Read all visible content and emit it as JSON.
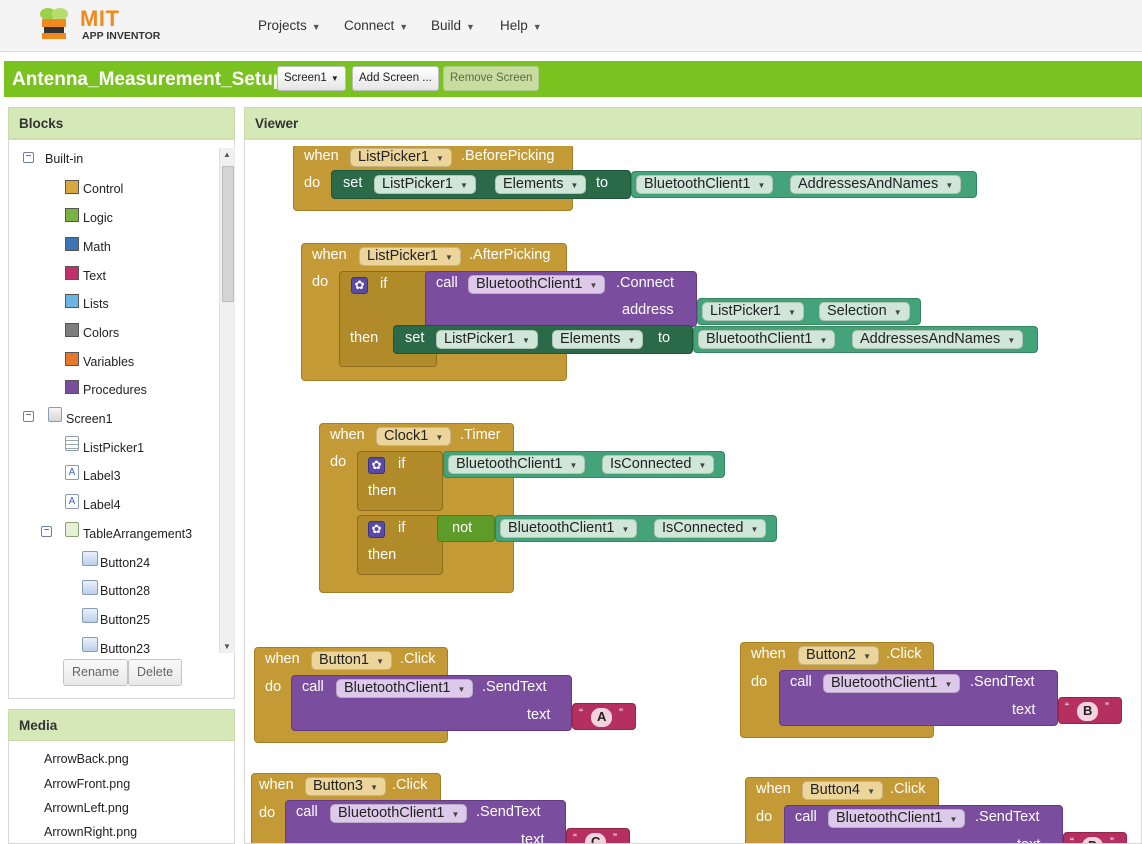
{
  "header": {
    "logo_title": "MIT",
    "logo_subtitle": "APP INVENTOR",
    "nav": [
      {
        "label": "Projects"
      },
      {
        "label": "Connect"
      },
      {
        "label": "Build"
      },
      {
        "label": "Help"
      }
    ]
  },
  "project": {
    "name": "Antenna_Measurement_Setup",
    "screen_select": "Screen1",
    "add_screen": "Add Screen ...",
    "remove_screen": "Remove Screen"
  },
  "blocks_panel": {
    "title": "Blocks",
    "builtin": {
      "label": "Built-in",
      "items": [
        {
          "label": "Control",
          "color": "#d9a93f"
        },
        {
          "label": "Logic",
          "color": "#7bb342"
        },
        {
          "label": "Math",
          "color": "#3d74b5"
        },
        {
          "label": "Text",
          "color": "#c2306c"
        },
        {
          "label": "Lists",
          "color": "#6bb3e0"
        },
        {
          "label": "Colors",
          "color": "#7d7d7d"
        },
        {
          "label": "Variables",
          "color": "#e6782d"
        },
        {
          "label": "Procedures",
          "color": "#7b4d9e"
        }
      ]
    },
    "screen": {
      "label": "Screen1",
      "components": [
        {
          "label": "ListPicker1",
          "icon": "listpicker-icon"
        },
        {
          "label": "Label3",
          "icon": "label-icon"
        },
        {
          "label": "Label4",
          "icon": "label-icon"
        }
      ],
      "arrangement": {
        "label": "TableArrangement3",
        "children": [
          {
            "label": "Button24"
          },
          {
            "label": "Button28"
          },
          {
            "label": "Button25"
          },
          {
            "label": "Button23"
          }
        ]
      }
    },
    "rename": "Rename",
    "delete": "Delete"
  },
  "media_panel": {
    "title": "Media",
    "files": [
      "ArrowBack.png",
      "ArrowFront.png",
      "ArrownLeft.png",
      "ArrownRight.png"
    ]
  },
  "viewer": {
    "title": "Viewer",
    "kw": {
      "when": "when",
      "do": "do",
      "set": "set",
      "to": "to",
      "call": "call",
      "if": "if",
      "then": "then",
      "not": "not",
      "address": "address",
      "text": "text"
    },
    "b1": {
      "comp": "ListPicker1",
      "event": ".BeforePicking",
      "set_comp": "ListPicker1",
      "set_prop": "Elements",
      "get_comp": "BluetoothClient1",
      "get_prop": "AddressesAndNames"
    },
    "b2": {
      "comp": "ListPicker1",
      "event": ".AfterPicking",
      "call_comp": "BluetoothClient1",
      "method": ".Connect",
      "arg_comp": "ListPicker1",
      "arg_prop": "Selection",
      "set_comp": "ListPicker1",
      "set_prop": "Elements",
      "get_comp": "BluetoothClient1",
      "get_prop": "AddressesAndNames"
    },
    "b3": {
      "comp": "Clock1",
      "event": ".Timer",
      "if1_comp": "BluetoothClient1",
      "if1_prop": "IsConnected",
      "if2_comp": "BluetoothClient1",
      "if2_prop": "IsConnected"
    },
    "b4": {
      "comp": "Button1",
      "event": ".Click",
      "call_comp": "BluetoothClient1",
      "method": ".SendText",
      "value": "A"
    },
    "b5": {
      "comp": "Button2",
      "event": ".Click",
      "call_comp": "BluetoothClient1",
      "method": ".SendText",
      "value": "B"
    },
    "b6": {
      "comp": "Button3",
      "event": ".Click",
      "call_comp": "BluetoothClient1",
      "method": ".SendText",
      "value": "C"
    },
    "b7": {
      "comp": "Button4",
      "event": ".Click",
      "call_comp": "BluetoothClient1",
      "method": ".SendText",
      "value": "D"
    }
  }
}
